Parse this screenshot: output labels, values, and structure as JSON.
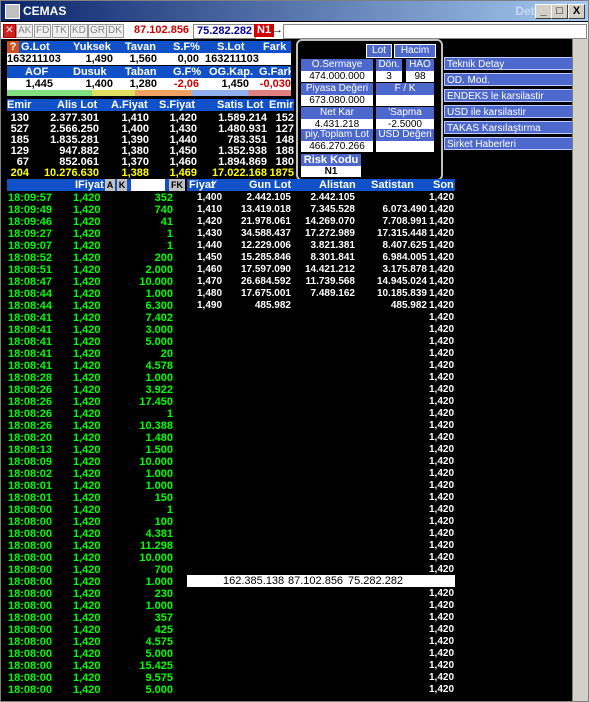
{
  "window": {
    "title": "CEMAS",
    "ghost_title": "Detay",
    "min": "_",
    "max": "□",
    "close": "X"
  },
  "toolbar": {
    "buttons": [
      "AK",
      "FD",
      "TK",
      "KD",
      "GR",
      "DK"
    ],
    "volume_red": "87.102.856",
    "volume_blue": "75.282.282",
    "tag": "N1"
  },
  "row1": {
    "headers": [
      "G.Lot",
      "Yuksek",
      "Tavan",
      "S.F%",
      "S.Lot",
      "Fark"
    ],
    "values": [
      "163211103",
      "1,490",
      "1,560",
      "0,00",
      "163211103",
      ""
    ]
  },
  "row2": {
    "headers": [
      "AOF",
      "Dusuk",
      "Taban",
      "G.F%",
      "OG.Kap.",
      "G.Fark"
    ],
    "values": [
      "1,445",
      "1,400",
      "1,280",
      "-2,06",
      "1,450",
      "-0,030"
    ]
  },
  "depth": {
    "headers": [
      "Emir",
      "Alis Lot",
      "A.Fiyat",
      "S.Fiyat",
      "Satis Lot",
      "Emir"
    ],
    "rows": [
      [
        "130",
        "2.377.301",
        "1,410",
        "1,420",
        "1.589.214",
        "152"
      ],
      [
        "527",
        "2.566.250",
        "1,400",
        "1,430",
        "1.480.931",
        "127"
      ],
      [
        "185",
        "1.835.281",
        "1,390",
        "1,440",
        "783.351",
        "148"
      ],
      [
        "129",
        "947.882",
        "1,380",
        "1,450",
        "1.352.938",
        "188"
      ],
      [
        "67",
        "852.061",
        "1,370",
        "1,460",
        "1.894.869",
        "180"
      ]
    ],
    "total": [
      "204",
      "10.276.630",
      "1,388",
      "1,469",
      "17.022.168",
      "1875"
    ]
  },
  "panel": {
    "lot_btn": "Lot",
    "hacim_btn": "Hacim",
    "o_sermaye_lbl": "O.Sermaye",
    "o_sermaye_val": "474.000.000",
    "don_lbl": "Dön.",
    "don_val": "3",
    "hao_lbl": "HAO",
    "hao_val": "98",
    "piyasa_lbl": "Piyasa Değeri",
    "piyasa_val": "673.080.000",
    "fk_lbl": "F / K",
    "fk_val": "",
    "netkar_lbl": "Net Kar",
    "netkar_val": "4.431.218",
    "sapma_lbl": "'Sapma",
    "sapma_val": "-2.5000",
    "ptoplam_lbl": "piy.Toplam Lot",
    "ptoplam_val": "466.270.266",
    "usd_lbl": "USD Değeri",
    "usd_val": "",
    "risk_lbl": "Risk Kodu",
    "risk_val": "N1"
  },
  "menu": [
    "Teknik Detay",
    "OD. Mod.",
    "ENDEKS le karsilastir",
    "USD ile karsilastir",
    "TAKAS Karsılaştırma",
    "Sirket Haberleri"
  ],
  "trades": {
    "headers": {
      "fiyat": "IFiyat",
      "a": "A",
      "k": "K",
      "fk": "FK"
    },
    "rows": [
      [
        "18:09:57",
        "1,420",
        "352"
      ],
      [
        "18:09:49",
        "1,420",
        "740"
      ],
      [
        "18:09:46",
        "1,420",
        "41"
      ],
      [
        "18:09:27",
        "1,420",
        "1"
      ],
      [
        "18:09:07",
        "1,420",
        "1"
      ],
      [
        "18:08:52",
        "1,420",
        "200"
      ],
      [
        "18:08:51",
        "1,420",
        "2.000"
      ],
      [
        "18:08:47",
        "1,420",
        "10.000"
      ],
      [
        "18:08:44",
        "1,420",
        "1.000"
      ],
      [
        "18:08:44",
        "1,420",
        "6.300"
      ],
      [
        "18:08:41",
        "1,420",
        "7.402"
      ],
      [
        "18:08:41",
        "1,420",
        "3.000"
      ],
      [
        "18:08:41",
        "1,420",
        "5.000"
      ],
      [
        "18:08:41",
        "1,420",
        "20"
      ],
      [
        "18:08:41",
        "1,420",
        "4.578"
      ],
      [
        "18:08:28",
        "1,420",
        "1.000"
      ],
      [
        "18:08:26",
        "1,420",
        "3.922"
      ],
      [
        "18:08:26",
        "1,420",
        "17.450"
      ],
      [
        "18:08:26",
        "1,420",
        "1"
      ],
      [
        "18:08:26",
        "1,420",
        "10.388"
      ],
      [
        "18:08:20",
        "1,420",
        "1.480"
      ],
      [
        "18:08:13",
        "1,420",
        "1.500"
      ],
      [
        "18:08:09",
        "1,420",
        "10.000"
      ],
      [
        "18:08:02",
        "1,420",
        "1.000"
      ],
      [
        "18:08:01",
        "1,420",
        "1.000"
      ],
      [
        "18:08:01",
        "1,420",
        "150"
      ],
      [
        "18:08:00",
        "1,420",
        "1"
      ],
      [
        "18:08:00",
        "1,420",
        "100"
      ],
      [
        "18:08:00",
        "1,420",
        "4.381"
      ],
      [
        "18:08:00",
        "1,420",
        "11.298"
      ],
      [
        "18:08:00",
        "1,420",
        "10.000"
      ],
      [
        "18:08:00",
        "1,420",
        "700"
      ],
      [
        "18:08:00",
        "1,420",
        "1.000"
      ],
      [
        "18:08:00",
        "1,420",
        "230"
      ],
      [
        "18:08:00",
        "1,420",
        "1.000"
      ],
      [
        "18:08:00",
        "1,420",
        "357"
      ],
      [
        "18:08:00",
        "1,420",
        "425"
      ],
      [
        "18:08:00",
        "1,420",
        "4.575"
      ],
      [
        "18:08:00",
        "1,420",
        "5.000"
      ],
      [
        "18:08:00",
        "1,420",
        "15.425"
      ],
      [
        "18:08:00",
        "1,420",
        "9.575"
      ],
      [
        "18:08:00",
        "1,420",
        "5.000"
      ]
    ]
  },
  "gunluk": {
    "headers": [
      "Fiyat",
      "Gun Lot",
      "Alistan",
      "Satistan",
      "Son"
    ],
    "rows": [
      [
        "1,400",
        "2.442.105",
        "2.442.105",
        ""
      ],
      [
        "1,410",
        "13.419.018",
        "7.345.528",
        "6.073.490"
      ],
      [
        "1,420",
        "21.978.061",
        "14.269.070",
        "7.708.991"
      ],
      [
        "1,430",
        "34.588.437",
        "17.272.989",
        "17.315.448"
      ],
      [
        "1,440",
        "12.229.006",
        "3.821.381",
        "8.407.625"
      ],
      [
        "1,450",
        "15.285.846",
        "8.301.841",
        "6.984.005"
      ],
      [
        "1,460",
        "17.597.090",
        "14.421.212",
        "3.175.878"
      ],
      [
        "1,470",
        "26.684.592",
        "11.739.568",
        "14.945.024"
      ],
      [
        "1,480",
        "17.675.001",
        "7.489.162",
        "10.185.839"
      ],
      [
        "1,490",
        "485.982",
        "",
        "485.982"
      ]
    ],
    "son_col": "1,420",
    "total": [
      "162.385.138",
      "87.102.856",
      "75.282.282"
    ]
  }
}
